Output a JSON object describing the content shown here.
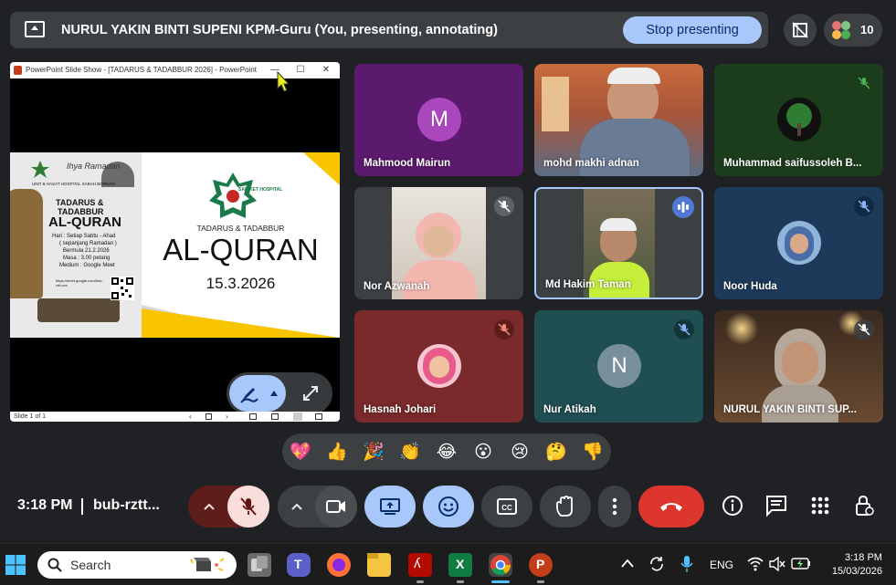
{
  "banner": {
    "text": "NURUL YAKIN BINTI SUPENI KPM-Guru (You, presenting, annotating)",
    "stop_label": "Stop presenting",
    "participant_count": "10"
  },
  "presentation": {
    "window_title": "PowerPoint Slide Show - [TADARUS & TADABBUR 2026] - PowerPoint",
    "minimize": "—",
    "maximize": "☐",
    "close": "✕",
    "slide_status": "Slide 1 of 1",
    "poster": {
      "org": "UNIT & HASAT HOSPITAL SABAH BORNAM",
      "script": "Ihya Ramadan",
      "title1": "TADARUS &",
      "title2": "TADABBUR",
      "title3": "AL-QURAN",
      "line1": "Hari : Setiap Sabtu - Ahad",
      "line2": "( sepanjang Ramadan )",
      "line3": "Bermula 21.2.2026",
      "line4": "Masa : 3.00 petang",
      "line5": "Medium : Google Meet",
      "link": "https://meet.google.com/bub-rztt-xxx"
    },
    "slide": {
      "logo_text": "SAINKET HOSPITAL",
      "subtitle": "TADARUS & TADABBUR",
      "title": "AL-QURAN",
      "date": "15.3.2026"
    }
  },
  "participants": [
    {
      "name": "Mahmood Mairun",
      "avatar_letter": "M",
      "avatar_color": "#9c27b0",
      "bg": "#5c1a6e"
    },
    {
      "name": "mohd makhi adnan"
    },
    {
      "name": "Muhammad saifussoleh B..."
    },
    {
      "name": "Nor Azwanah"
    },
    {
      "name": "Md Hakim Taman"
    },
    {
      "name": "Noor Huda"
    },
    {
      "name": "Hasnah Johari"
    },
    {
      "name": "Nur Atikah",
      "avatar_letter": "N"
    },
    {
      "name": "NURUL YAKIN BINTI SUP..."
    }
  ],
  "reactions": [
    "💖",
    "👍",
    "🎉",
    "👏",
    "😂",
    "😮",
    "😢",
    "🤔",
    "👎"
  ],
  "controls": {
    "time": "3:18 PM",
    "meeting_code": "bub-rztt..."
  },
  "taskbar": {
    "search_placeholder": "Search",
    "language": "ENG",
    "time": "3:18 PM",
    "date": "15/03/2026"
  },
  "colors": {
    "accent": "#a8c7fa",
    "end_call": "#dc362e",
    "mute_red": "#f9dedc"
  }
}
